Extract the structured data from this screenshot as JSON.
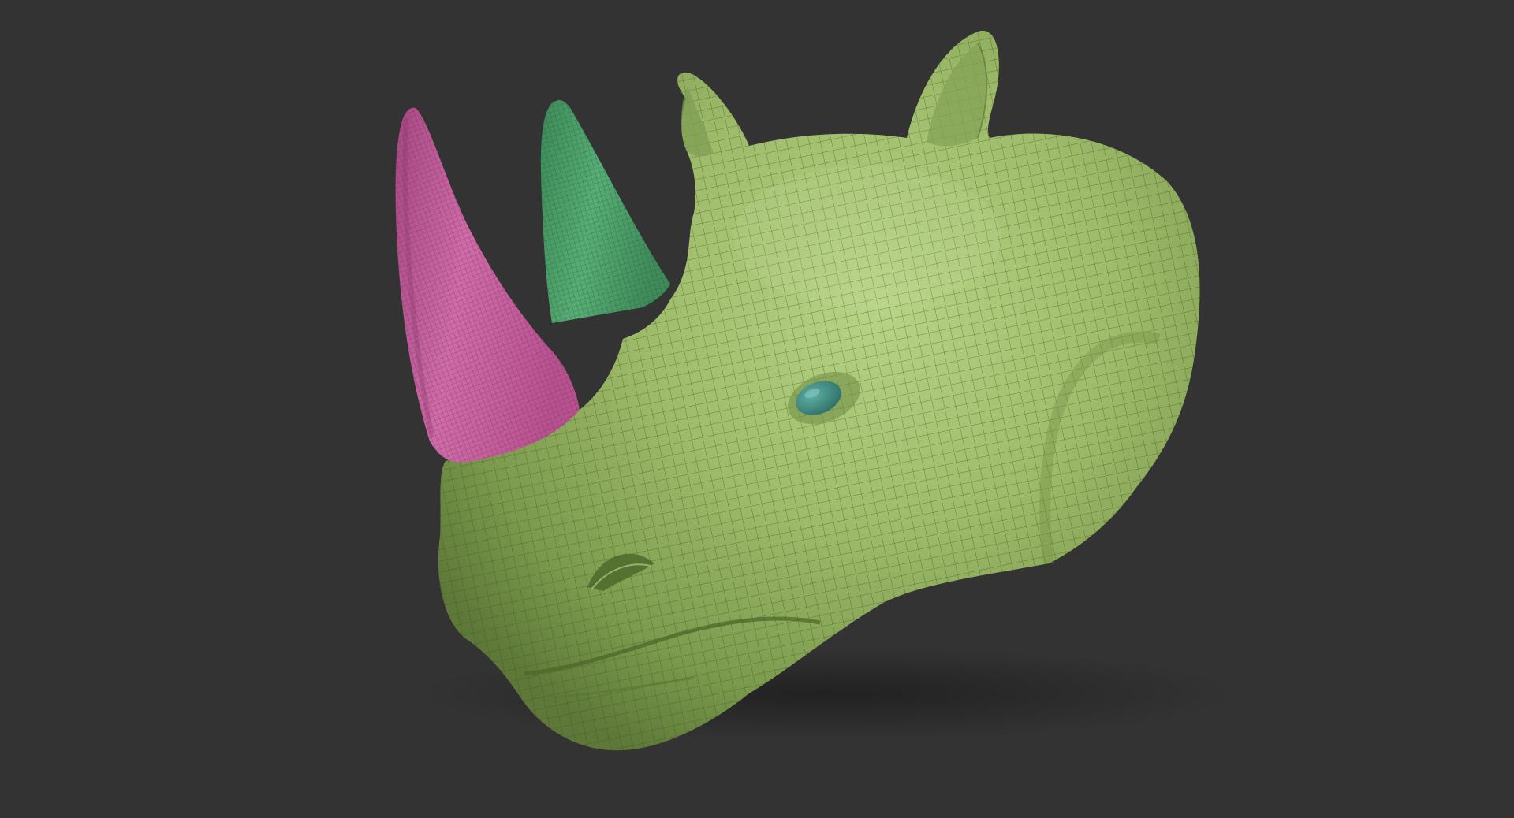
{
  "viewport": {
    "background_color": "#333333"
  },
  "model": {
    "subject": "rhino-head",
    "display": "polyframe-wireframe",
    "subtools": [
      {
        "part": "head",
        "color": "#9fbd6b"
      },
      {
        "part": "front-horn",
        "color": "#c0609a"
      },
      {
        "part": "rear-horn",
        "color": "#4ba06a"
      },
      {
        "part": "eye",
        "color": "#3f8f85"
      }
    ],
    "wireframe_color": "#2a3a1e"
  }
}
